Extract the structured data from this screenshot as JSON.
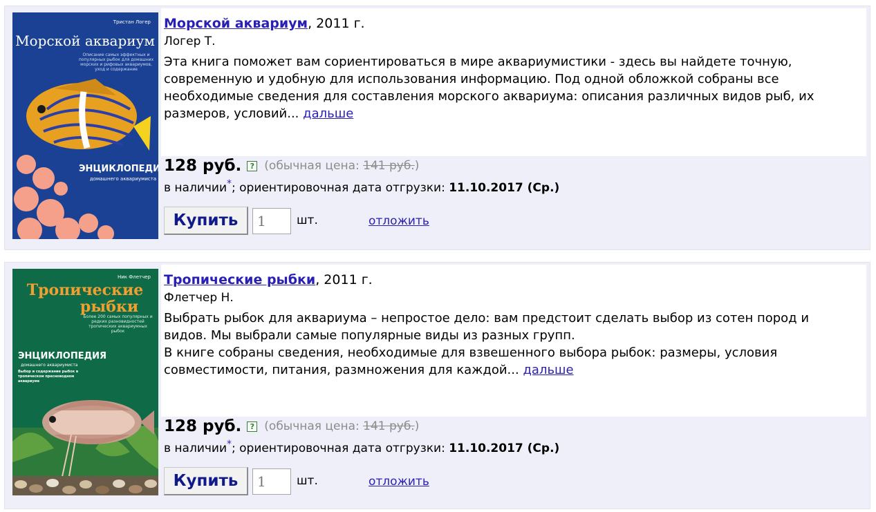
{
  "books": [
    {
      "title": "Морской аквариум",
      "year": ", 2011 г.",
      "author": "Логер Т.",
      "description": [
        "Эта книга поможет вам сориентироваться в мире аквариумистики - здесь вы найдете точную, современную и удобную для использования информацию. Под одной обложкой собраны все необходимые сведения для составления морского аквариума: описания различных видов рыб, их размеров, условий..."
      ],
      "more_label": "дальше",
      "price": "128 руб.",
      "regular_prefix": "(обычная цена: ",
      "regular_price": "141 руб.",
      "regular_suffix": ")",
      "stock_text": "в наличии",
      "stock_star": "*",
      "shipping_text": "; ориентировочная дата отгрузки: ",
      "shipping_date": "11.10.2017 (Ср.)",
      "buy_label": "Купить",
      "qty_value": "1",
      "unit": "шт.",
      "postpone_label": "отложить",
      "cover": {
        "author": "Тристан Логер",
        "title": "Морской аквариум",
        "blurb": "Описание самых эффектных и популярных рыбок для домашних морских и рифовых аквариумов, уход и содержание",
        "series": "ЭНЦИКЛОПЕДИЯ",
        "series_sub": "домашнего аквариумиста",
        "bg_color": "#1f4aa0",
        "title_color": "#ffffff"
      }
    },
    {
      "title": "Тропические рыбки",
      "year": ", 2011 г.",
      "author": "Флетчер Н.",
      "description": [
        "Выбрать рыбок для аквариума – непростое дело: вам предстоит сделать выбор из сотен пород и видов. Мы выбрали самые популярные виды из разных групп.",
        "В книге собраны сведения, необходимые для взвешенного выбора рыбок: размеры, условия совместимости, питания, размножения для каждой..."
      ],
      "more_label": "дальше",
      "price": "128 руб.",
      "regular_prefix": "(обычная цена: ",
      "regular_price": "141 руб.",
      "regular_suffix": ")",
      "stock_text": "в наличии",
      "stock_star": "*",
      "shipping_text": "; ориентировочная дата отгрузки: ",
      "shipping_date": "11.10.2017 (Ср.)",
      "buy_label": "Купить",
      "qty_value": "1",
      "unit": "шт.",
      "postpone_label": "отложить",
      "cover": {
        "author": "Ник Флетчер",
        "title_l1": "Тропические",
        "title_l2": "рыбки",
        "blurb": "Более 200 самых популярных и редких разновидностей тропических аквариумных рыбок",
        "series": "ЭНЦИКЛОПЕДИЯ",
        "series_sub": "домашнего аквариумиста",
        "extra": "Выбор и содержание рыбок в тропическом пресноводном аквариуме",
        "bg_color": "#0f6a48",
        "title_color": "#f0a030"
      }
    }
  ]
}
